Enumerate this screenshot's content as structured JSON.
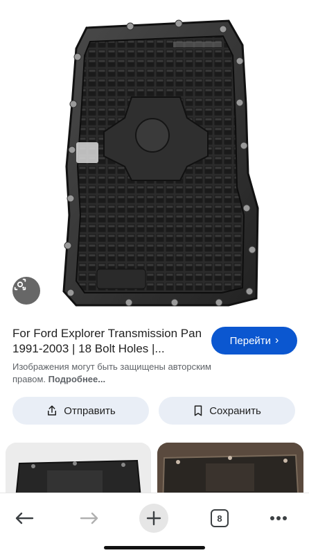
{
  "result": {
    "title": "For Ford Explorer Transmission Pan 1991-2003 | 18 Bolt Holes |...",
    "visit_label": "Перейти",
    "copyright_text": "Изображения могут быть защищены авторским правом.",
    "more_label": "Подробнее..."
  },
  "actions": {
    "share_label": "Отправить",
    "save_label": "Сохранить"
  },
  "nav": {
    "tab_count": "8"
  },
  "colors": {
    "accent": "#0b57d0",
    "pill_bg": "#e9eef6"
  },
  "icons": [
    "lens-icon",
    "share-icon",
    "bookmark-icon",
    "back-arrow-icon",
    "forward-arrow-icon",
    "plus-icon",
    "tabs-icon",
    "more-icon"
  ]
}
